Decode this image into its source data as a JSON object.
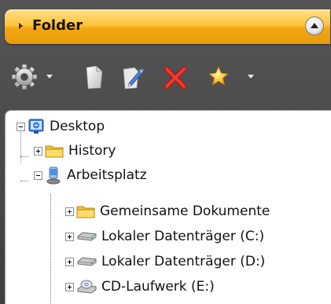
{
  "header": {
    "title": "Folder"
  },
  "toolbar": {
    "items": [
      {
        "name": "settings",
        "icon": "gear-icon",
        "has_dropdown": true
      },
      {
        "name": "new",
        "icon": "document-icon"
      },
      {
        "name": "edit",
        "icon": "edit-icon"
      },
      {
        "name": "delete",
        "icon": "delete-x-icon"
      },
      {
        "name": "favorites",
        "icon": "star-icon",
        "has_dropdown": true
      }
    ]
  },
  "tree": {
    "nodes": [
      {
        "label": "Desktop",
        "icon": "desktop-icon",
        "expanded": true
      },
      {
        "label": "History",
        "icon": "folder-icon",
        "expanded": false
      },
      {
        "label": "Arbeitsplatz",
        "icon": "computer-icon",
        "expanded": true
      },
      {
        "label": "Gemeinsame Dokumente",
        "icon": "folder-icon",
        "expanded": false
      },
      {
        "label": "Lokaler Datenträger (C:)",
        "icon": "drive-icon",
        "expanded": false
      },
      {
        "label": "Lokaler Datenträger (D:)",
        "icon": "drive-icon",
        "expanded": false
      },
      {
        "label": "CD-Laufwerk (E:)",
        "icon": "cd-drive-icon",
        "expanded": false
      }
    ]
  },
  "colors": {
    "header_top": "#ffe08a",
    "header_bottom": "#e99b0a",
    "panel_bg": "#4a4a4a",
    "tree_bg": "#ffffff",
    "delete_red": "#e8322a",
    "star_yellow": "#ffc21a"
  }
}
